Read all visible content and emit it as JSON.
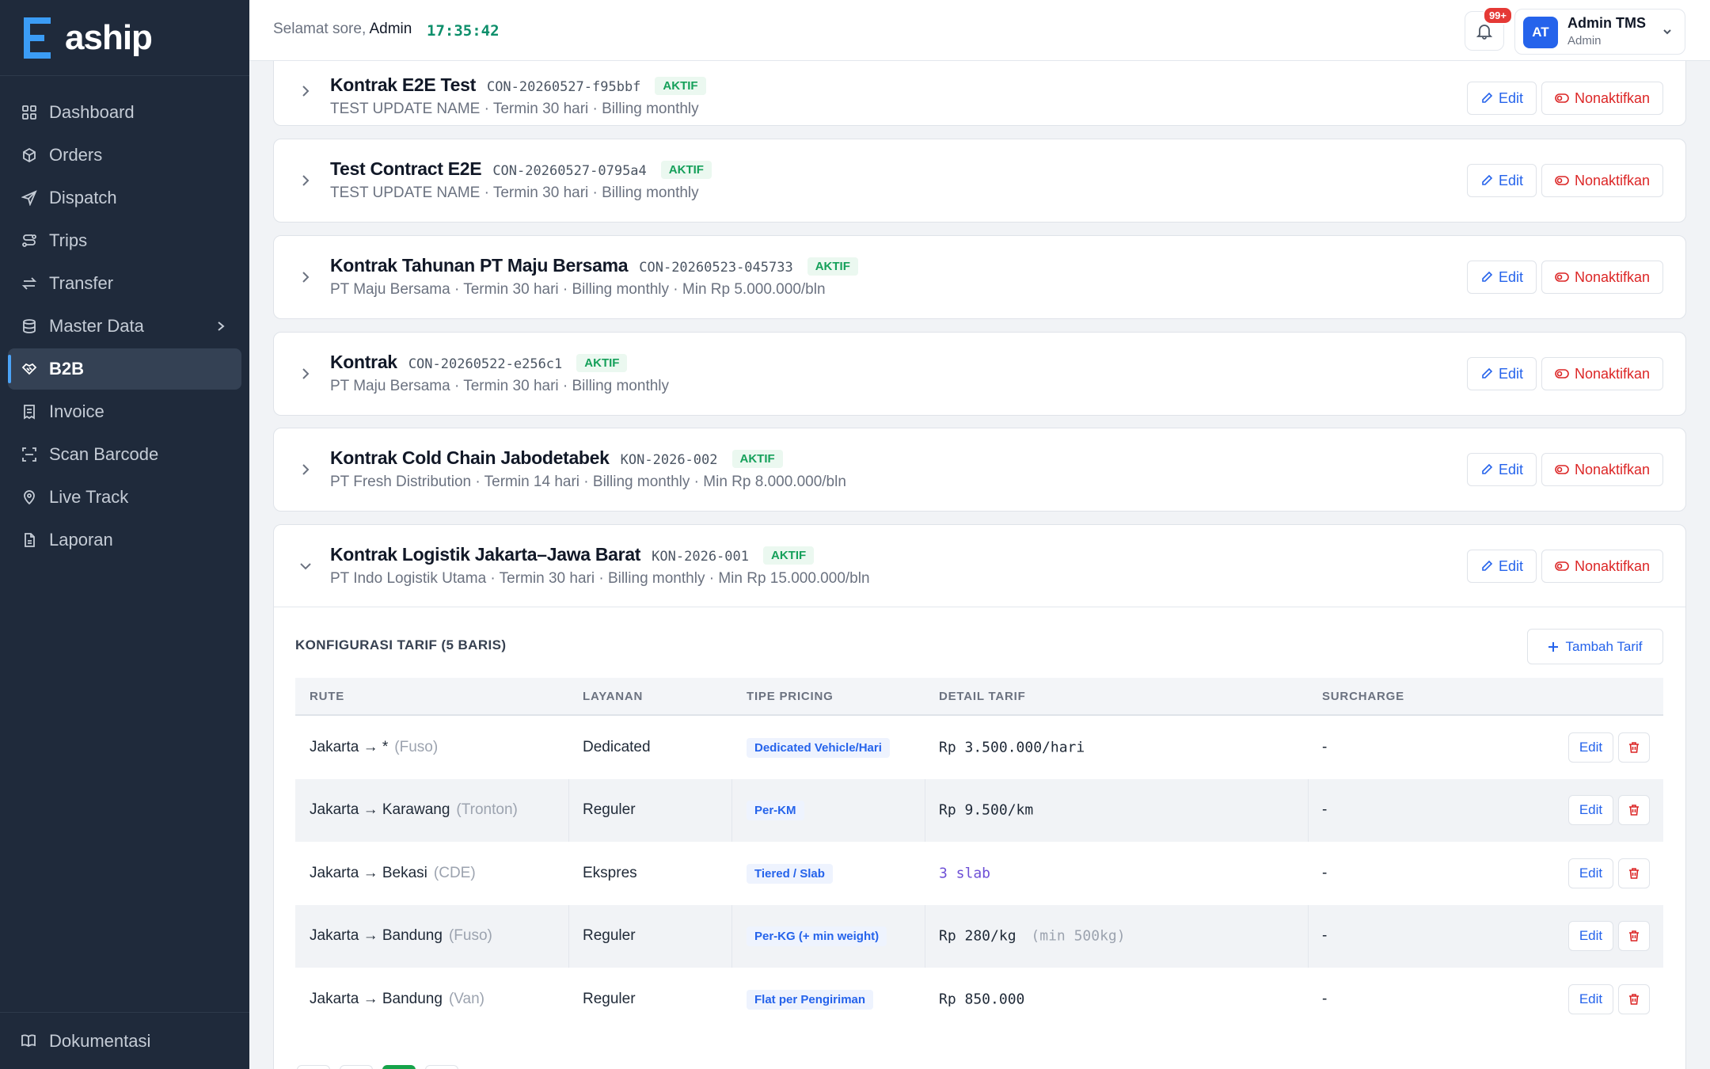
{
  "brand": {
    "name": "aship",
    "accent": "#3b9cf5"
  },
  "sidebar": {
    "items": [
      {
        "label": "Dashboard",
        "icon": "grid-icon"
      },
      {
        "label": "Orders",
        "icon": "package-icon"
      },
      {
        "label": "Dispatch",
        "icon": "send-icon"
      },
      {
        "label": "Trips",
        "icon": "route-icon"
      },
      {
        "label": "Transfer",
        "icon": "arrows-swap-icon"
      },
      {
        "label": "Master Data",
        "icon": "database-icon"
      },
      {
        "label": "B2B",
        "icon": "handshake-icon"
      },
      {
        "label": "Invoice",
        "icon": "receipt-icon"
      },
      {
        "label": "Scan Barcode",
        "icon": "scan-icon"
      },
      {
        "label": "Live Track",
        "icon": "map-pin-icon"
      },
      {
        "label": "Laporan",
        "icon": "document-icon"
      }
    ],
    "active": "B2B",
    "footer": {
      "label": "Dokumentasi",
      "icon": "book-icon"
    }
  },
  "header": {
    "greeting": "Selamat sore,",
    "greeting_name": "Admin",
    "clock": "17:35:42",
    "notification_badge": "99+",
    "user": {
      "initials": "AT",
      "name": "Admin TMS",
      "role": "Admin"
    }
  },
  "contracts": [
    {
      "title": "Kontrak E2E Test",
      "code": "CON-20260527-f95bbf",
      "status": "AKTIF",
      "subtitle": "TEST UPDATE NAME · Termin 30 hari · Billing monthly"
    },
    {
      "title": "Test Contract E2E",
      "code": "CON-20260527-0795a4",
      "status": "AKTIF",
      "subtitle": "TEST UPDATE NAME · Termin 30 hari · Billing monthly"
    },
    {
      "title": "Kontrak Tahunan PT Maju Bersama",
      "code": "CON-20260523-045733",
      "status": "AKTIF",
      "subtitle": "PT Maju Bersama · Termin 30 hari · Billing monthly · Min Rp 5.000.000/bln"
    },
    {
      "title": "Kontrak",
      "code": "CON-20260522-e256c1",
      "status": "AKTIF",
      "subtitle": "PT Maju Bersama · Termin 30 hari · Billing monthly"
    },
    {
      "title": "Kontrak Cold Chain Jabodetabek",
      "code": "KON-2026-002",
      "status": "AKTIF",
      "subtitle": "PT Fresh Distribution · Termin 14 hari · Billing monthly · Min Rp 8.000.000/bln"
    },
    {
      "title": "Kontrak Logistik Jakarta–Jawa Barat",
      "code": "KON-2026-001",
      "status": "AKTIF",
      "subtitle": "PT Indo Logistik Utama · Termin 30 hari · Billing monthly · Min Rp 15.000.000/bln",
      "expanded": true
    }
  ],
  "actions": {
    "edit": "Edit",
    "deactivate": "Nonaktifkan"
  },
  "tariff": {
    "title": "KONFIGURASI TARIF (5 BARIS)",
    "add_label": "Tambah Tarif",
    "columns": [
      "RUTE",
      "LAYANAN",
      "TIPE PRICING",
      "DETAIL TARIF",
      "SURCHARGE"
    ],
    "rows": [
      {
        "route": "Jakarta → *",
        "vehicle": "(Fuso)",
        "service": "Dedicated",
        "pricing": "Dedicated Vehicle/Hari",
        "detail": "Rp 3.500.000/hari",
        "detail_note": "",
        "surcharge": "-"
      },
      {
        "route": "Jakarta → Karawang",
        "vehicle": "(Tronton)",
        "service": "Reguler",
        "pricing": "Per-KM",
        "detail": "Rp 9.500/km",
        "detail_note": "",
        "surcharge": "-"
      },
      {
        "route": "Jakarta → Bekasi",
        "vehicle": "(CDE)",
        "service": "Ekspres",
        "pricing": "Tiered / Slab",
        "detail": "3 slab",
        "detail_note": "",
        "surcharge": "-"
      },
      {
        "route": "Jakarta → Bandung",
        "vehicle": "(Fuso)",
        "service": "Reguler",
        "pricing": "Per-KG (+ min weight)",
        "detail": "Rp 280/kg",
        "detail_note": "(min 500kg)",
        "surcharge": "-"
      },
      {
        "route": "Jakarta → Bandung",
        "vehicle": "(Van)",
        "service": "Reguler",
        "pricing": "Flat per Pengiriman",
        "detail": "Rp 850.000",
        "detail_note": "",
        "surcharge": "-"
      }
    ],
    "row_edit": "Edit"
  },
  "colors": {
    "sidebar_bg": "#1f2a3b",
    "primary": "#2563eb",
    "success": "#15a05a",
    "danger": "#dc2626"
  }
}
